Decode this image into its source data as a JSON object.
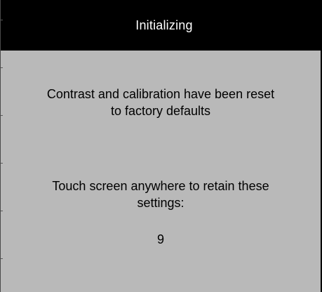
{
  "dialog": {
    "title": "Initializing",
    "reset_message": {
      "line1": "Contrast and calibration have been reset",
      "line2": "to factory defaults"
    },
    "touch_message": {
      "line1": "Touch screen anywhere to retain these",
      "line2": "settings:"
    },
    "countdown": "9"
  },
  "colors": {
    "title_bar": "#000000",
    "title_text": "#ffffff",
    "background": "#b9b9b9",
    "text": "#000000"
  }
}
